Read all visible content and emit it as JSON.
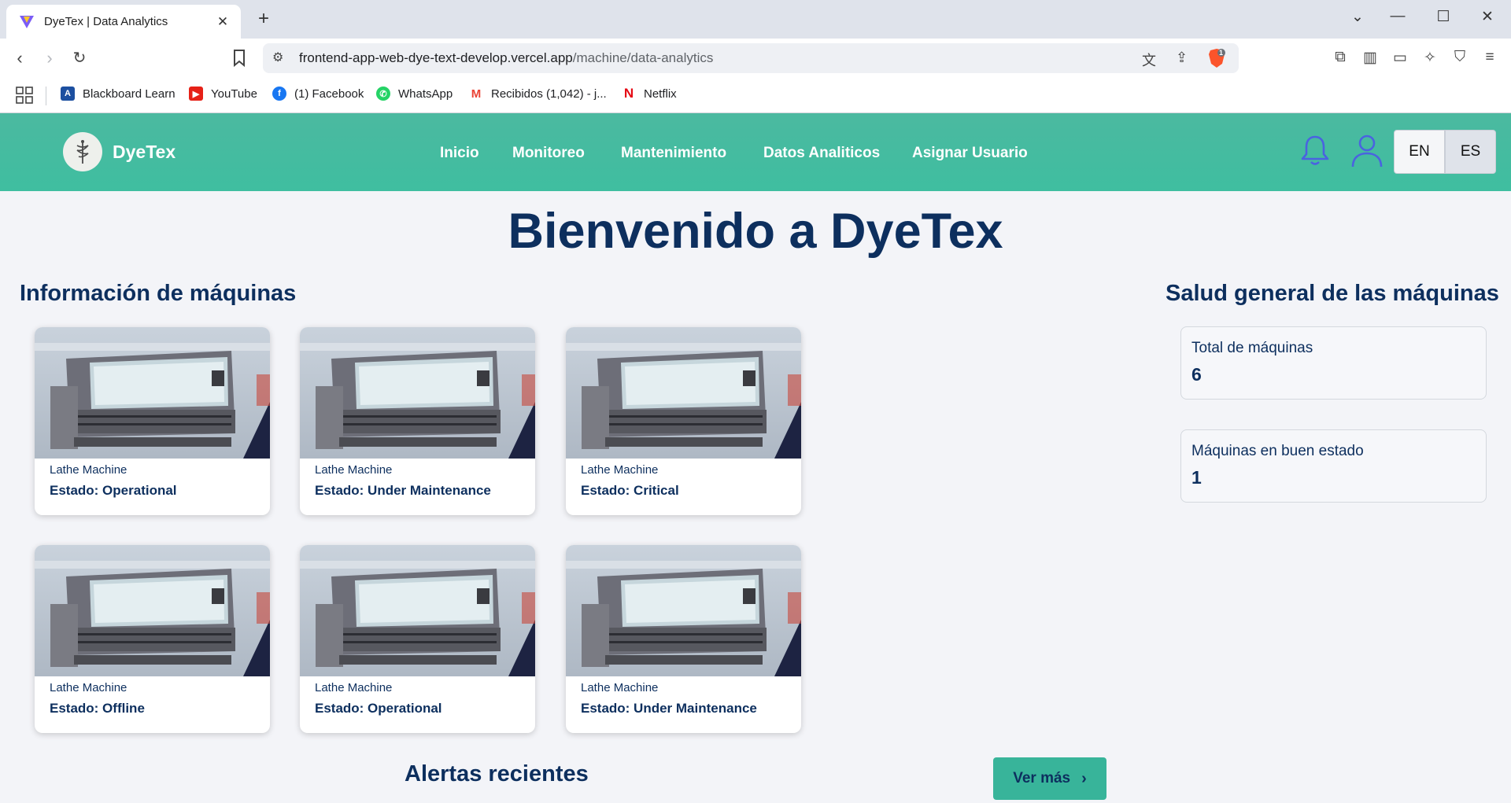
{
  "browser": {
    "tab_title": "DyeTex | Data Analytics",
    "url_host": "frontend-app-web-dye-text-develop.vercel.app",
    "url_path": "/machine/data-analytics",
    "shield_count": "1",
    "bookmarks": [
      {
        "label": "Blackboard Learn",
        "icon": "blackboard-icon",
        "color": "#1c4fa0"
      },
      {
        "label": "YouTube",
        "icon": "youtube-icon",
        "color": "#e62117"
      },
      {
        "label": "(1) Facebook",
        "icon": "facebook-icon",
        "color": "#1877f2"
      },
      {
        "label": "WhatsApp",
        "icon": "whatsapp-icon",
        "color": "#25d366"
      },
      {
        "label": "Recibidos (1,042) - j...",
        "icon": "gmail-icon",
        "color": "#ea4335"
      },
      {
        "label": "Netflix",
        "icon": "netflix-icon",
        "color": "#e50914"
      }
    ]
  },
  "header": {
    "brand": "DyeTex",
    "nav": [
      "Inicio",
      "Monitoreo",
      "Mantenimiento",
      "Datos Analiticos",
      "Asignar Usuario"
    ],
    "lang_en": "EN",
    "lang_es": "ES",
    "accent_color": "#3fbea0"
  },
  "main": {
    "title": "Bienvenido a DyeTex",
    "machines_title": "Información de máquinas",
    "health_title": "Salud general de las máquinas",
    "machines": [
      {
        "name": "Lathe Machine",
        "status": "Estado: Operational"
      },
      {
        "name": "Lathe Machine",
        "status": "Estado: Under Maintenance"
      },
      {
        "name": "Lathe Machine",
        "status": "Estado: Critical"
      },
      {
        "name": "Lathe Machine",
        "status": "Estado: Offline"
      },
      {
        "name": "Lathe Machine",
        "status": "Estado: Operational"
      },
      {
        "name": "Lathe Machine",
        "status": "Estado: Under Maintenance"
      }
    ],
    "stats": {
      "total_label": "Total de máquinas",
      "total_value": "6",
      "good_label": "Máquinas en buen estado",
      "good_value": "1"
    },
    "alerts_title": "Alertas recientes",
    "more_button": "Ver más"
  }
}
